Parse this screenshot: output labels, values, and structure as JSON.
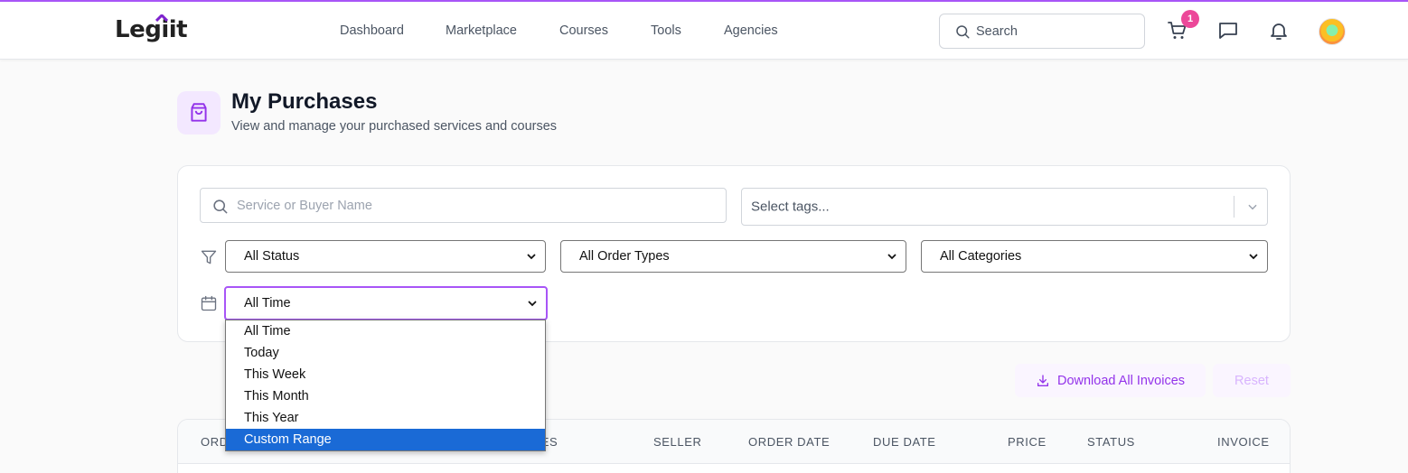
{
  "brand": {
    "logo_text": "Legiit",
    "accent": "#a855f7"
  },
  "nav": {
    "items": [
      {
        "label": "Dashboard"
      },
      {
        "label": "Marketplace"
      },
      {
        "label": "Courses"
      },
      {
        "label": "Tools"
      },
      {
        "label": "Agencies"
      }
    ],
    "search_placeholder": "Search",
    "cart_count": "1"
  },
  "header": {
    "title": "My Purchases",
    "subtitle": "View and manage your purchased services and courses"
  },
  "filters": {
    "search_placeholder": "Service or Buyer Name",
    "tags_placeholder": "Select tags...",
    "status": {
      "selected": "All Status"
    },
    "order_types": {
      "selected": "All Order Types"
    },
    "categories": {
      "selected": "All Categories"
    },
    "time": {
      "selected": "All Time",
      "options": [
        "All Time",
        "Today",
        "This Week",
        "This Month",
        "This Year",
        "Custom Range"
      ],
      "highlighted": "Custom Range"
    }
  },
  "actions": {
    "download_label": "Download All Invoices",
    "reset_label": "Reset"
  },
  "table": {
    "columns": [
      "ORDER",
      "SERVICES",
      "SELLER",
      "ORDER DATE",
      "DUE DATE",
      "PRICE",
      "STATUS",
      "INVOICE"
    ]
  }
}
